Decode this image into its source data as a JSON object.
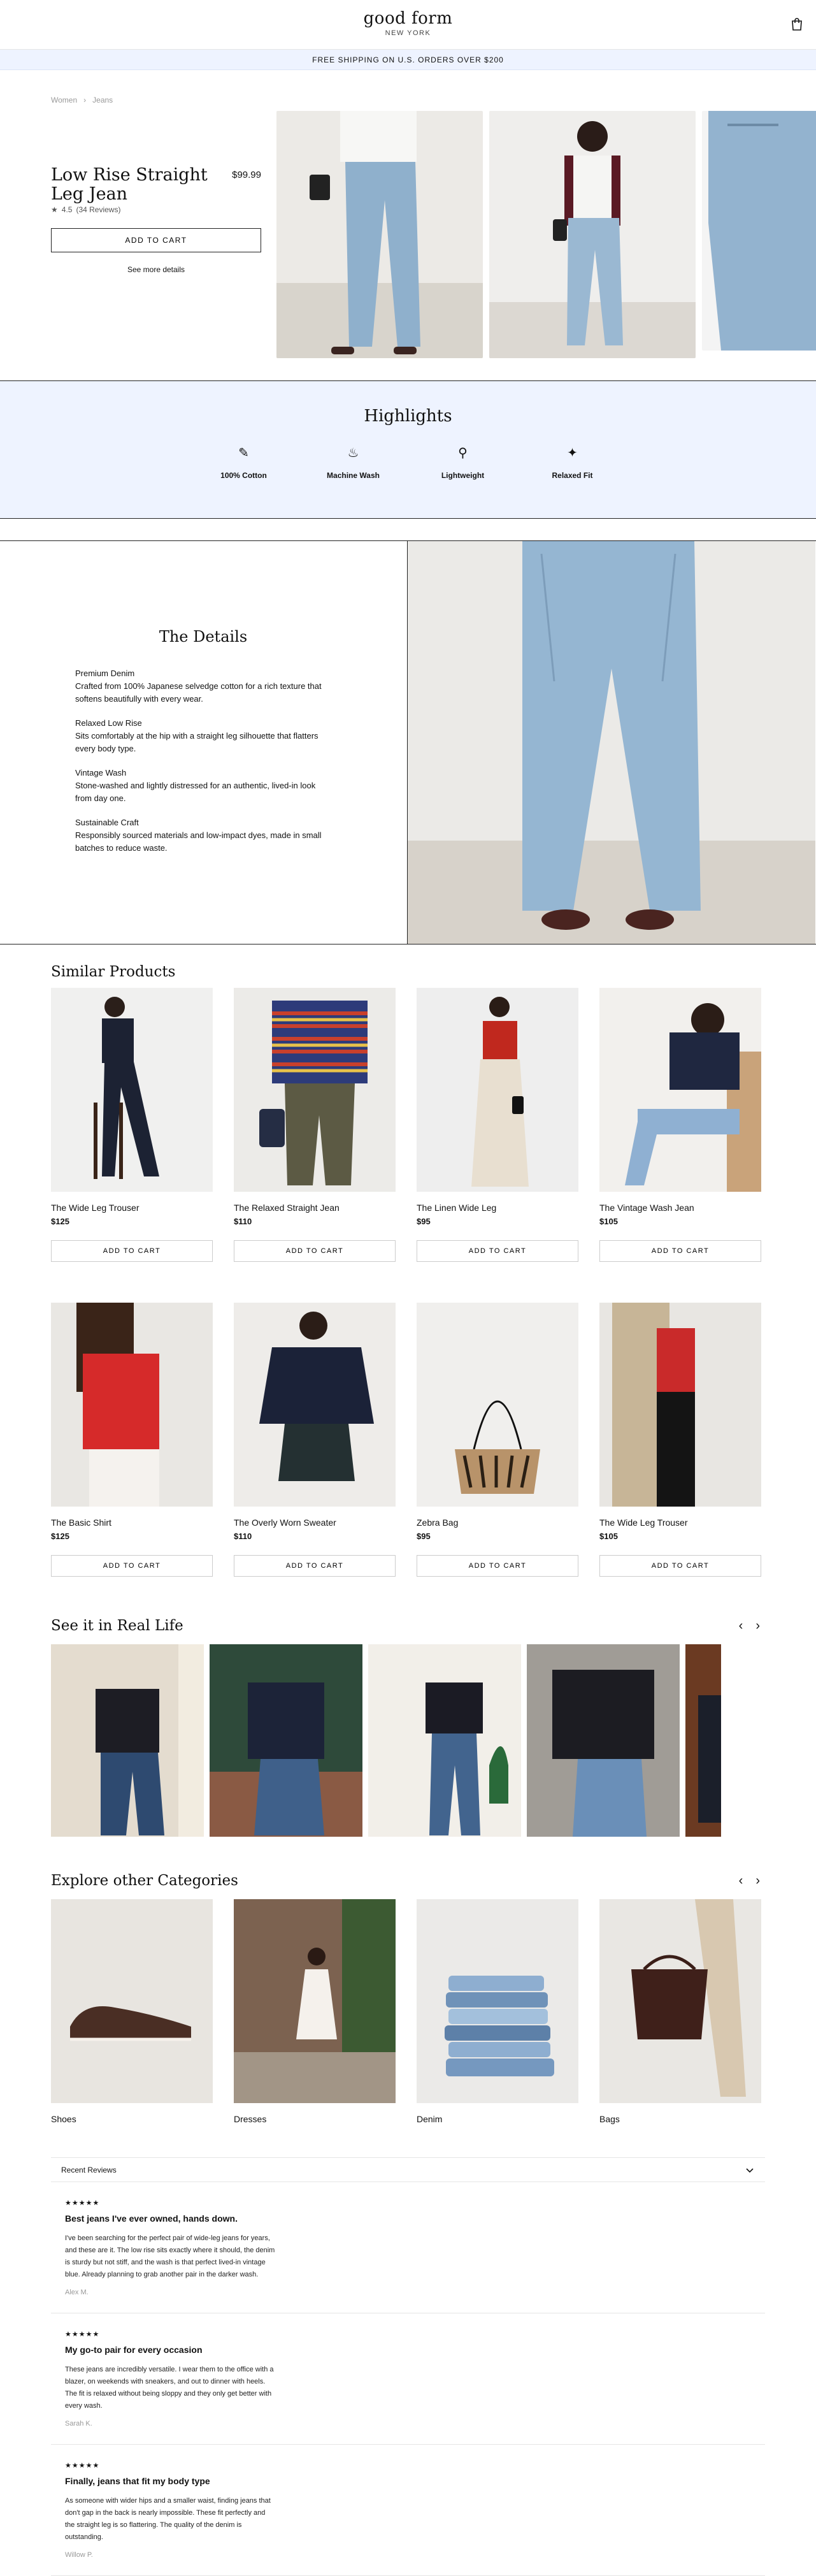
{
  "header": {
    "brand": "good form",
    "location": "NEW YORK"
  },
  "promo": "FREE SHIPPING ON U.S. ORDERS OVER $200",
  "breadcrumb": [
    "Women",
    "Jeans"
  ],
  "product": {
    "title": "Low Rise Straight Leg Jean",
    "price": "$99.99",
    "rating": "4.5",
    "reviews_count": "(34 Reviews)",
    "add_to_cart": "ADD TO CART",
    "see_more": "See more details"
  },
  "highlights": {
    "title": "Highlights",
    "items": [
      {
        "label": "100% Cotton",
        "icon": "needle-icon"
      },
      {
        "label": "Machine Wash",
        "icon": "washing-icon"
      },
      {
        "label": "Lightweight",
        "icon": "feather-icon"
      },
      {
        "label": "Relaxed Fit",
        "icon": "sparkle-icon"
      }
    ]
  },
  "details": {
    "title": "The Details",
    "blocks": [
      {
        "heading": "Premium Denim",
        "text": "Crafted from 100% Japanese selvedge cotton for a rich texture that softens beautifully with every wear."
      },
      {
        "heading": "Relaxed Low Rise",
        "text": "Sits comfortably at the hip with a straight leg silhouette that flatters every body type."
      },
      {
        "heading": "Vintage Wash",
        "text": "Stone-washed and lightly distressed for an authentic, lived-in look from day one."
      },
      {
        "heading": "Sustainable Craft",
        "text": "Responsibly sourced materials and low-impact dyes, made in small batches to reduce waste."
      }
    ]
  },
  "similar": {
    "title": "Similar Products",
    "cta": "ADD TO CART",
    "items": [
      {
        "name": "The Wide Leg Trouser",
        "price": "$125"
      },
      {
        "name": "The Relaxed Straight Jean",
        "price": "$110"
      },
      {
        "name": "The Linen Wide Leg",
        "price": "$95"
      },
      {
        "name": "The Vintage Wash Jean",
        "price": "$105"
      },
      {
        "name": "The Basic Shirt",
        "price": "$125"
      },
      {
        "name": "The Overly Worn Sweater",
        "price": "$110"
      },
      {
        "name": "Zebra Bag",
        "price": "$95"
      },
      {
        "name": "The Wide Leg Trouser",
        "price": "$105"
      }
    ]
  },
  "real_life": {
    "title": "See it in Real Life"
  },
  "categories": {
    "title": "Explore other Categories",
    "items": [
      "Shoes",
      "Dresses",
      "Denim",
      "Bags"
    ]
  },
  "reviews": {
    "title": "Recent Reviews",
    "items": [
      {
        "stars": "★★★★★",
        "title": "Best jeans I've ever owned, hands down.",
        "body": "I've been searching for the perfect pair of wide-leg jeans for years, and these are it. The low rise sits exactly where it should, the denim is sturdy but not stiff, and the wash is that perfect lived-in vintage blue. Already planning to grab another pair in the darker wash.",
        "author": "Alex M."
      },
      {
        "stars": "★★★★★",
        "title": "My go-to pair for every occasion",
        "body": "These jeans are incredibly versatile. I wear them to the office with a blazer, on weekends with sneakers, and out to dinner with heels. The fit is relaxed without being sloppy and they only get better with every wash.",
        "author": "Sarah K."
      },
      {
        "stars": "★★★★★",
        "title": "Finally, jeans that fit my body type",
        "body": "As someone with wider hips and a smaller waist, finding jeans that don't gap in the back is nearly impossible. These fit perfectly and the straight leg is so flattering. The quality of the denim is outstanding.",
        "author": "Willow P."
      }
    ]
  }
}
